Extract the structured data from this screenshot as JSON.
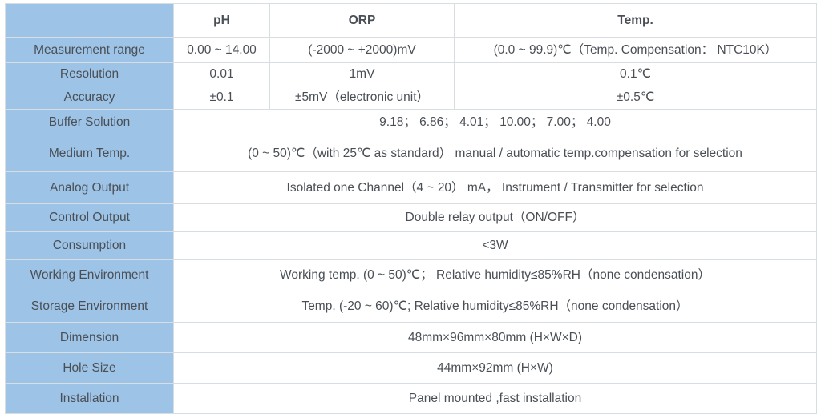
{
  "table": {
    "columns": [
      "",
      "pH",
      "ORP",
      "Temp."
    ],
    "rows": [
      {
        "label": "",
        "type": "header",
        "cells": [
          "pH",
          "ORP",
          "Temp."
        ]
      },
      {
        "label": "Measurement range",
        "type": "three",
        "ph": "0.00 ~ 14.00",
        "orp": "(-2000 ~ +2000)mV",
        "temp": "(0.0 ~ 99.9)℃（Temp. Compensation： NTC10K）"
      },
      {
        "label": "Resolution",
        "type": "three",
        "ph": "0.01",
        "orp": "1mV",
        "temp": "0.1℃"
      },
      {
        "label": "Accuracy",
        "type": "three",
        "ph": "±0.1",
        "orp": "±5mV（electronic unit）",
        "temp": "±0.5℃"
      },
      {
        "label": "Buffer Solution",
        "type": "span",
        "value": "9.18； 6.86； 4.01； 10.00； 7.00； 4.00",
        "align": "center"
      },
      {
        "label": "Medium Temp.",
        "type": "span",
        "value": "(0 ~ 50)℃（with 25℃ as standard） manual / automatic temp.compensation for selection",
        "align": "left"
      },
      {
        "label": "Analog Output",
        "type": "span",
        "value": "Isolated one Channel（4 ~ 20） mA， Instrument / Transmitter for selection",
        "align": "center"
      },
      {
        "label": "Control Output",
        "type": "span",
        "value": "Double relay output（ON/OFF）",
        "align": "center"
      },
      {
        "label": "Consumption",
        "type": "span",
        "value": "<3W",
        "align": "center"
      },
      {
        "label": "Working Environment",
        "type": "span",
        "value": "Working temp. (0 ~ 50)℃； Relative humidity≤85%RH（none condensation）",
        "align": "center"
      },
      {
        "label": "Storage Environment",
        "type": "span",
        "value": "Temp. (-20 ~ 60)℃; Relative humidity≤85%RH（none condensation）",
        "align": "center"
      },
      {
        "label": "Dimension",
        "type": "span",
        "value": "48mm×96mm×80mm (H×W×D)",
        "align": "center"
      },
      {
        "label": "Hole Size",
        "type": "span",
        "value": "44mm×92mm (H×W)",
        "align": "center"
      },
      {
        "label": "Installation",
        "type": "span",
        "value": "Panel mounted ,fast installation",
        "align": "center"
      }
    ]
  },
  "colors": {
    "header_blue": "#9dc3e6",
    "border": "#d8dde2",
    "text": "#4a4f55"
  }
}
